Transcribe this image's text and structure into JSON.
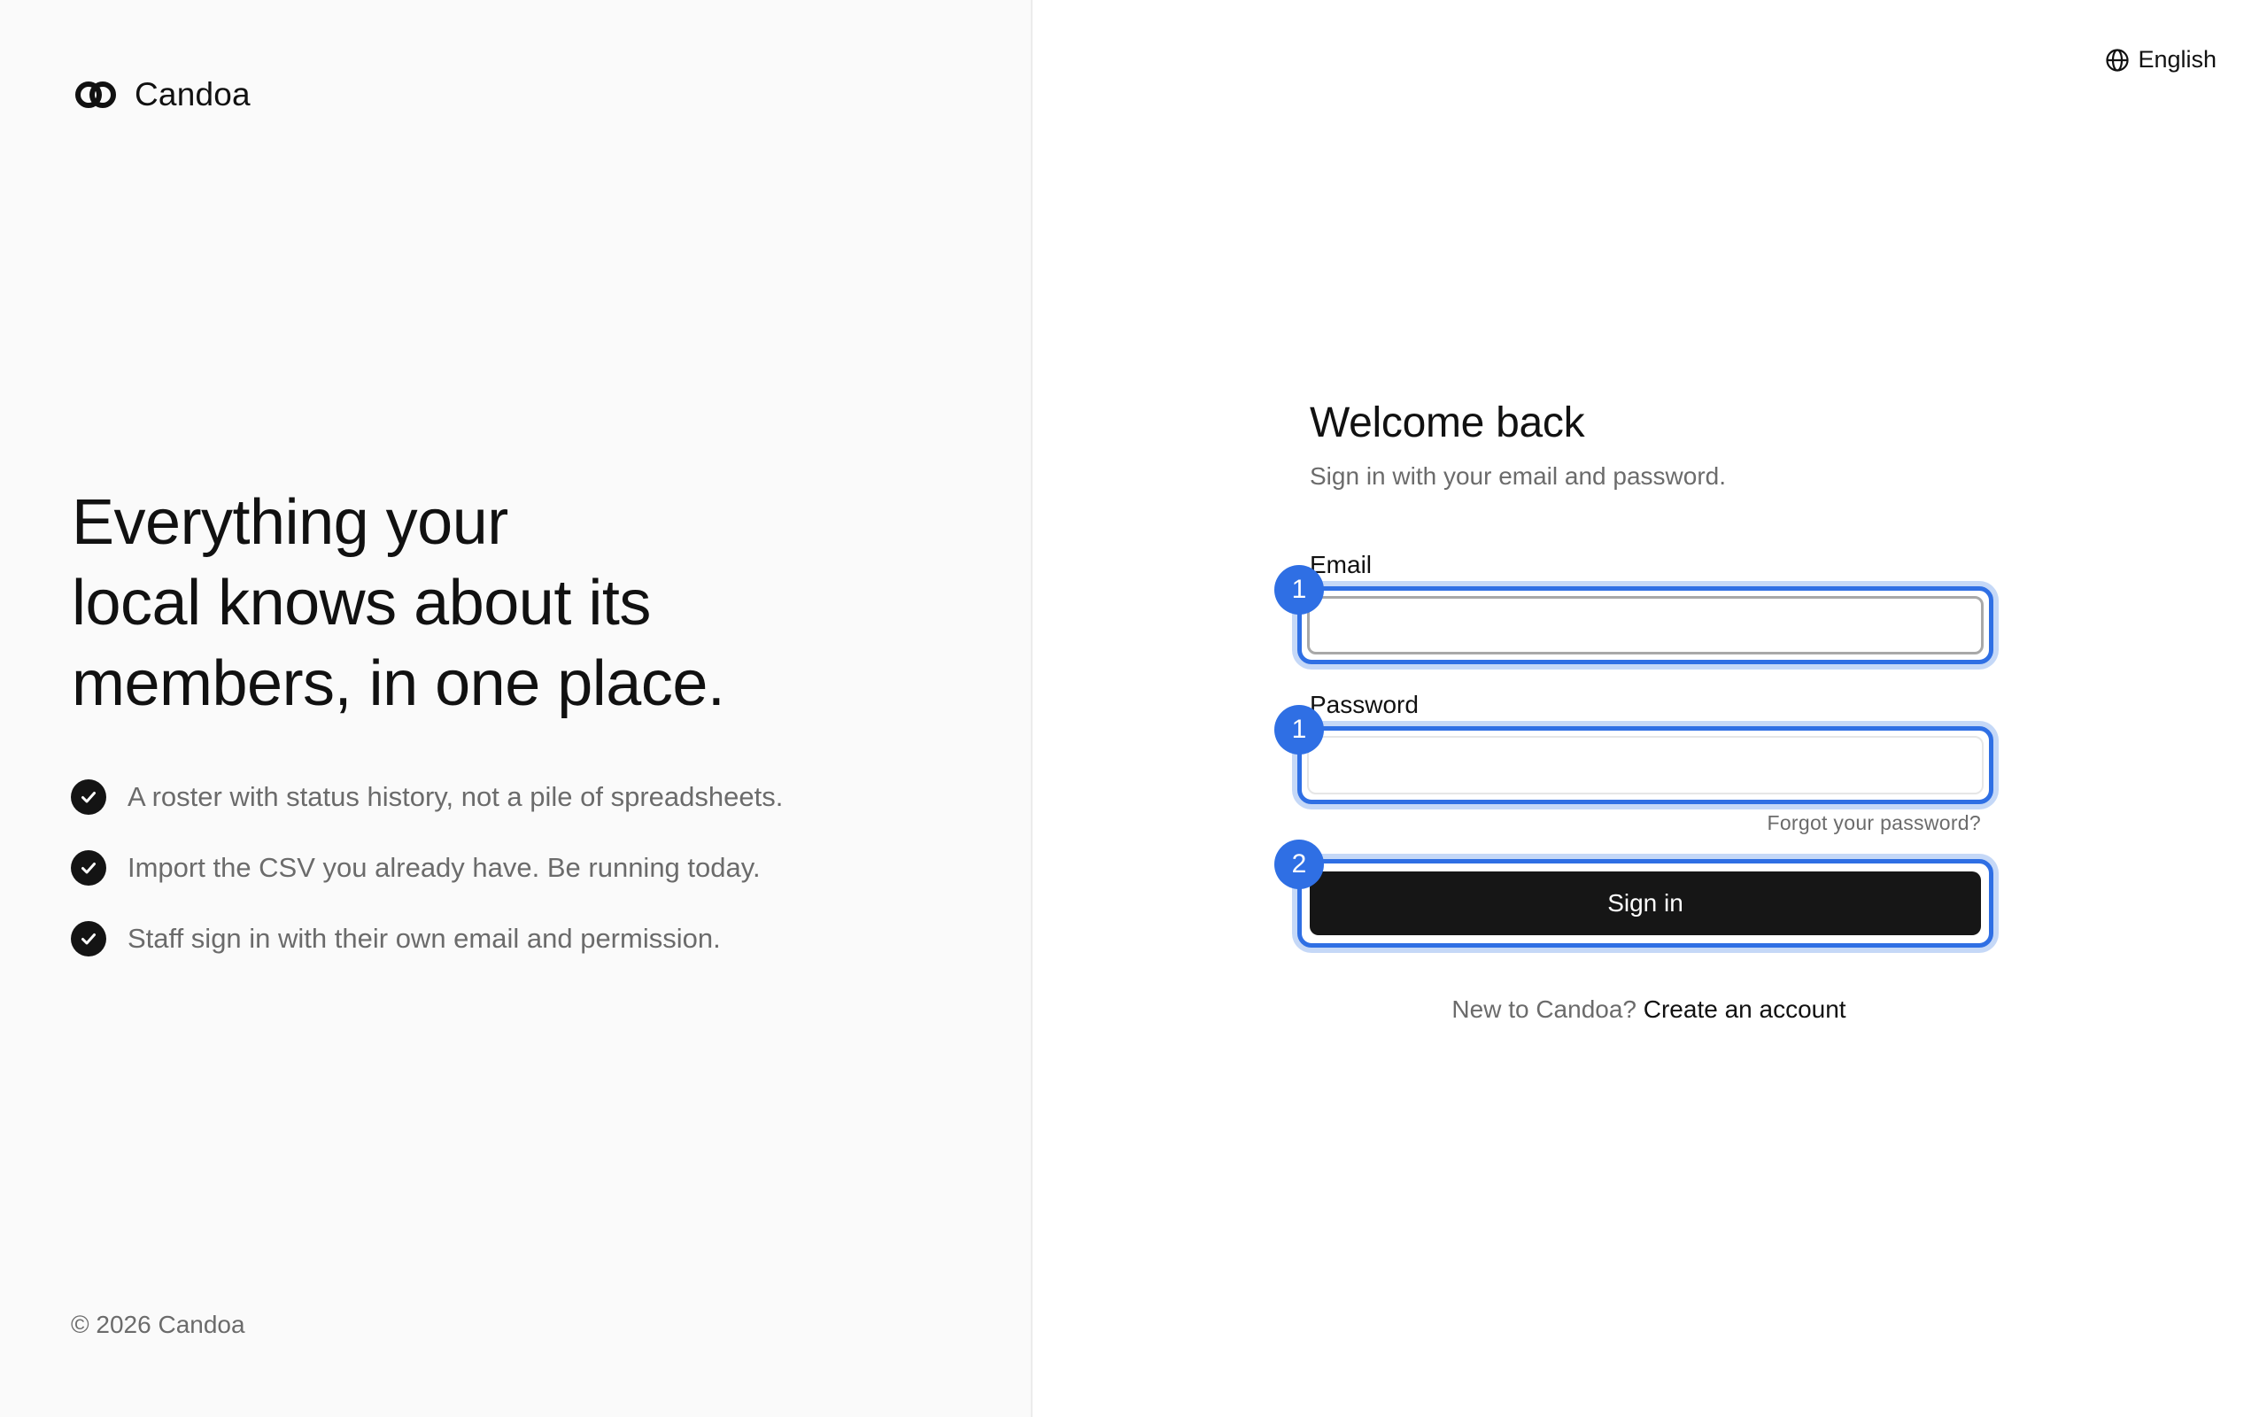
{
  "brand": {
    "name": "Candoa"
  },
  "hero": {
    "headline_line1": "Everything your",
    "headline_line2": "local knows about its",
    "headline_line3": "members, in one place.",
    "features": [
      "A roster with status history, not a pile of spreadsheets.",
      "Import the CSV you already have. Be running today.",
      "Staff sign in with their own email and permission."
    ]
  },
  "footer": {
    "copyright": "© 2026 Candoa"
  },
  "language": {
    "label": "English",
    "icon": "globe-icon"
  },
  "form": {
    "title": "Welcome back",
    "subtitle": "Sign in with your email and password.",
    "email_label": "Email",
    "email_value": "",
    "password_label": "Password",
    "password_value": "",
    "forgot_label": "Forgot your password?",
    "submit_label": "Sign in",
    "signup_prompt": "New to Candoa?",
    "signup_link": "Create an account"
  },
  "annotations": {
    "email_badge": "1",
    "password_badge": "1",
    "submit_badge": "2"
  },
  "colors": {
    "accent": "#2f6fe4",
    "accent_glow": "#c5d8f7",
    "button": "#161616",
    "left_bg": "#fafafa",
    "muted_text": "#6b6b6b"
  }
}
